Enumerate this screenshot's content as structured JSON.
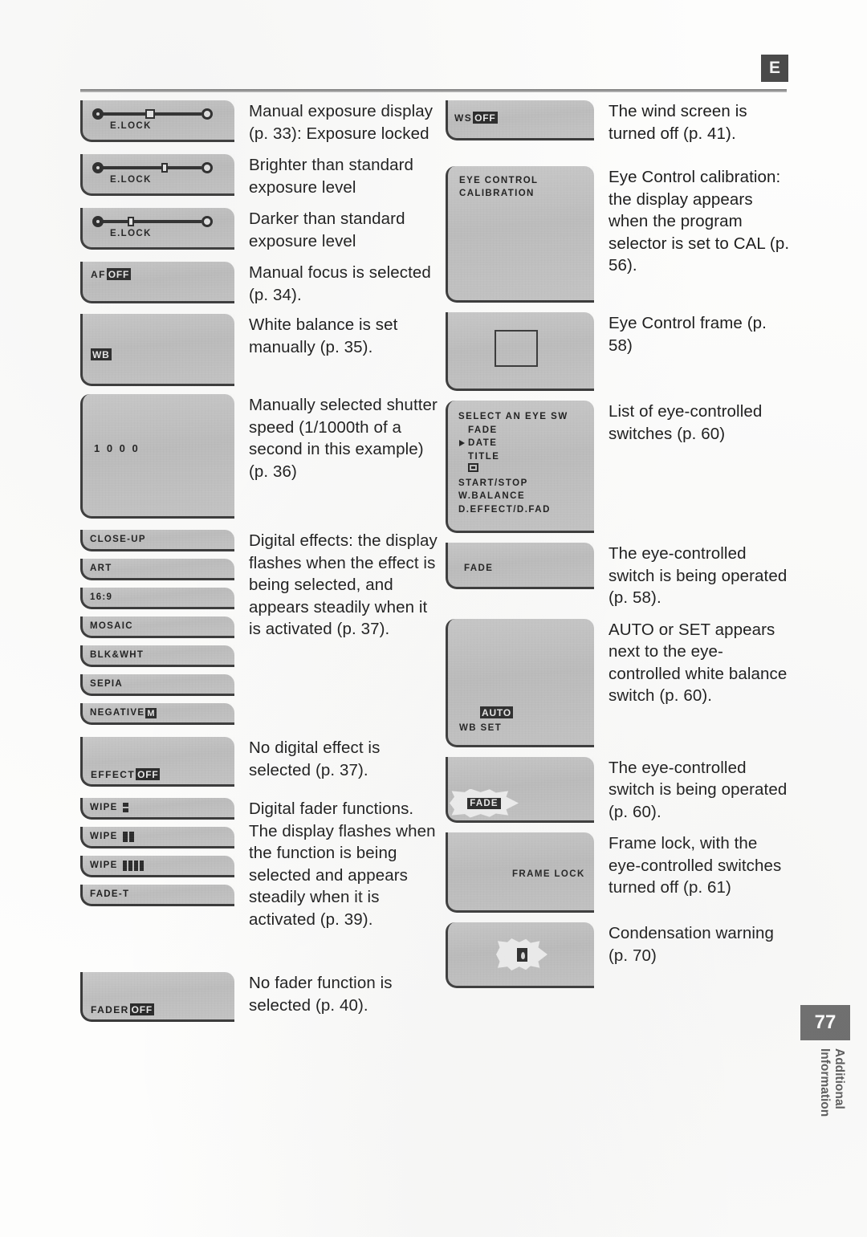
{
  "header": {
    "language_badge": "E"
  },
  "footer": {
    "page_number": "77",
    "section_tab": "Additional\nInformation"
  },
  "left_column": [
    {
      "id": "exposure-locked",
      "display_type": "exposure-slider",
      "marker": "square-center",
      "osd_label": "E.LOCK",
      "description": "Manual exposure display (p. 33): Exposure locked"
    },
    {
      "id": "exposure-brighter",
      "display_type": "exposure-slider",
      "marker": "right-of-center",
      "osd_label": "E.LOCK",
      "description": "Brighter than standard exposure level"
    },
    {
      "id": "exposure-darker",
      "display_type": "exposure-slider",
      "marker": "left-of-center",
      "osd_label": "E.LOCK",
      "description": "Darker than standard exposure level"
    },
    {
      "id": "manual-focus",
      "display_type": "badge",
      "osd_label": "AF",
      "osd_badge": "OFF",
      "description": "Manual focus is selected (p. 34)."
    },
    {
      "id": "white-balance-manual",
      "display_type": "badge-inverted",
      "osd_badge": "WB",
      "description": "White balance is set manually (p. 35)."
    },
    {
      "id": "shutter-speed",
      "display_type": "plain-value",
      "osd_label": "1 0 0 0",
      "description": "Manually selected shutter speed (1/1000th of a second in this example) (p. 36)"
    },
    {
      "id": "digital-effects",
      "display_type": "strip-list",
      "strips": [
        {
          "label": "CLOSE-UP",
          "glyph": "none"
        },
        {
          "label": "ART",
          "glyph": "none"
        },
        {
          "label": "16:9",
          "glyph": "none"
        },
        {
          "label": "MOSAIC",
          "glyph": "none"
        },
        {
          "label": "BLK&WHT",
          "glyph": "none"
        },
        {
          "label": "SEPIA",
          "glyph": "none"
        },
        {
          "label": "NEGATIVE",
          "glyph": "badge-M",
          "badge": "M"
        }
      ],
      "description": "Digital effects: the display flashes when the effect is being selected, and appears steadily when it is activated (p. 37)."
    },
    {
      "id": "no-digital-effect",
      "display_type": "badge",
      "osd_label": "EFFECT",
      "osd_badge": "OFF",
      "description": "No digital effect is selected (p. 37)."
    },
    {
      "id": "digital-fader",
      "display_type": "strip-list",
      "strips": [
        {
          "label": "WIPE",
          "glyph": "wipe-1"
        },
        {
          "label": "WIPE",
          "glyph": "wipe-2"
        },
        {
          "label": "WIPE",
          "glyph": "wipe-3"
        },
        {
          "label": "FADE-T",
          "glyph": "none"
        }
      ],
      "description": "Digital fader functions. The display flashes when the function is being selected and appears steadily when it is activated (p. 39)."
    },
    {
      "id": "no-fader",
      "display_type": "badge",
      "osd_label": "FADER",
      "osd_badge": "OFF",
      "description": "No fader function is selected (p. 40)."
    }
  ],
  "right_column": [
    {
      "id": "wind-screen-off",
      "display_type": "badge",
      "osd_label": "WS",
      "osd_badge": "OFF",
      "description": "The wind screen is turned off (p. 41)."
    },
    {
      "id": "eye-control-calibration",
      "display_type": "text-lines",
      "lines": [
        "EYE CONTROL",
        "CALIBRATION"
      ],
      "description": "Eye Control calibration: the display appears when the program selector is set to CAL (p. 56)."
    },
    {
      "id": "eye-control-frame",
      "display_type": "frame-rect",
      "description": "Eye Control frame (p. 58)"
    },
    {
      "id": "eye-switch-list",
      "display_type": "menu",
      "menu_title": "SELECT AN EYE SW",
      "menu_items": [
        {
          "label": "FADE",
          "selected": false
        },
        {
          "label": "DATE",
          "selected": true
        },
        {
          "label": "TITLE",
          "selected": false
        },
        {
          "label": "",
          "icon": "card-icon",
          "selected": false
        },
        {
          "label": "START/STOP",
          "selected": false
        },
        {
          "label": "W.BALANCE",
          "selected": false
        },
        {
          "label": "D.EFFECT/D.FAD",
          "selected": false
        }
      ],
      "description": "List of eye-controlled switches (p. 60)"
    },
    {
      "id": "eye-switch-operated-58",
      "display_type": "plain-value",
      "osd_label": "FADE",
      "description": "The eye-controlled switch is being operated (p. 58)."
    },
    {
      "id": "wb-auto-set",
      "display_type": "wb-set",
      "osd_badge": "AUTO",
      "osd_label": "WB  SET",
      "description": "AUTO or SET appears next to the eye-controlled white balance switch (p. 60)."
    },
    {
      "id": "eye-switch-operated-60",
      "display_type": "burst-fade",
      "osd_label": "FADE",
      "description": "The eye-controlled switch is being operated (p. 60)."
    },
    {
      "id": "frame-lock",
      "display_type": "plain-value",
      "osd_label": "FRAME  LOCK",
      "description": "Frame lock, with the eye-controlled switches turned off (p. 61)"
    },
    {
      "id": "condensation-warning",
      "display_type": "burst-drop",
      "description": "Condensation warning (p. 70)"
    }
  ]
}
